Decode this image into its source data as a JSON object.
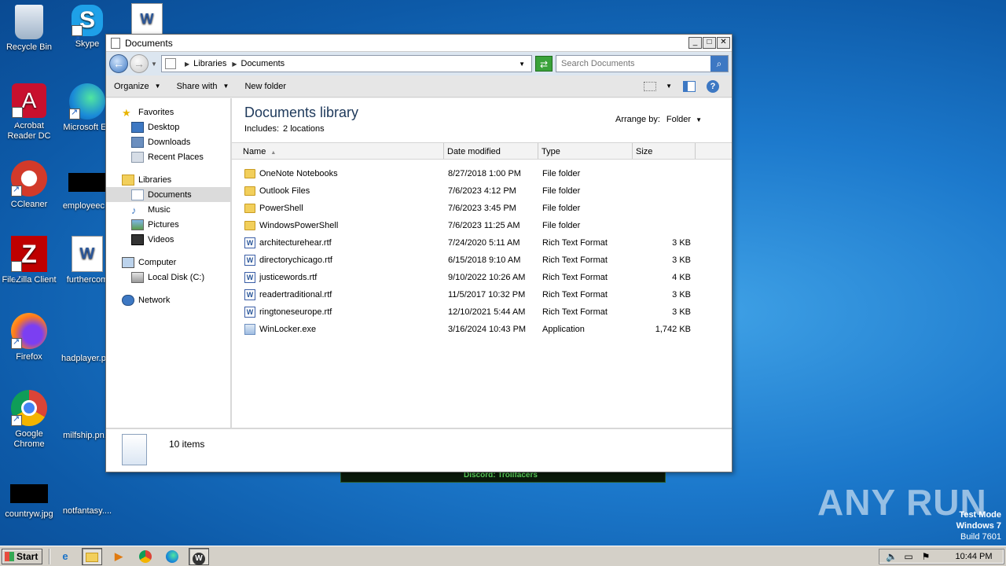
{
  "desktop": {
    "icons": [
      {
        "label": "Recycle Bin"
      },
      {
        "label": "Skype"
      },
      {
        "label": "Acrobat Reader DC"
      },
      {
        "label": "Microsoft Ed"
      },
      {
        "label": "CCleaner"
      },
      {
        "label": "employeec..."
      },
      {
        "label": "FileZilla Client"
      },
      {
        "label": "furthercom"
      },
      {
        "label": "Firefox"
      },
      {
        "label": "hadplayer.p..."
      },
      {
        "label": "Google Chrome"
      },
      {
        "label": "milfship.pn..."
      },
      {
        "label": "countryw.jpg"
      },
      {
        "label": "notfantasy...."
      }
    ]
  },
  "background_window": {
    "text": "Discord: Trollfacers"
  },
  "window": {
    "title": "Documents",
    "address": {
      "crumbs": [
        "Libraries",
        "Documents"
      ]
    },
    "search": {
      "placeholder": "Search Documents"
    },
    "toolbar": {
      "organize": "Organize",
      "share_with": "Share with",
      "new_folder": "New folder"
    },
    "nav": {
      "favorites": {
        "label": "Favorites",
        "items": [
          "Desktop",
          "Downloads",
          "Recent Places"
        ]
      },
      "libraries": {
        "label": "Libraries",
        "items": [
          "Documents",
          "Music",
          "Pictures",
          "Videos"
        ]
      },
      "computer": {
        "label": "Computer",
        "items": [
          "Local Disk (C:)"
        ]
      },
      "network": {
        "label": "Network"
      }
    },
    "library": {
      "title": "Documents library",
      "includes_label": "Includes:",
      "includes_value": "2 locations",
      "arrange_label": "Arrange by:",
      "arrange_value": "Folder"
    },
    "columns": {
      "name": "Name",
      "date": "Date modified",
      "type": "Type",
      "size": "Size"
    },
    "files": [
      {
        "name": "OneNote Notebooks",
        "date": "8/27/2018 1:00 PM",
        "type": "File folder",
        "size": "",
        "kind": "folder"
      },
      {
        "name": "Outlook Files",
        "date": "7/6/2023 4:12 PM",
        "type": "File folder",
        "size": "",
        "kind": "folder"
      },
      {
        "name": "PowerShell",
        "date": "7/6/2023 3:45 PM",
        "type": "File folder",
        "size": "",
        "kind": "folder"
      },
      {
        "name": "WindowsPowerShell",
        "date": "7/6/2023 11:25 AM",
        "type": "File folder",
        "size": "",
        "kind": "folder"
      },
      {
        "name": "architecturehear.rtf",
        "date": "7/24/2020 5:11 AM",
        "type": "Rich Text Format",
        "size": "3 KB",
        "kind": "rtf"
      },
      {
        "name": "directorychicago.rtf",
        "date": "6/15/2018 9:10 AM",
        "type": "Rich Text Format",
        "size": "3 KB",
        "kind": "rtf"
      },
      {
        "name": "justicewords.rtf",
        "date": "9/10/2022 10:26 AM",
        "type": "Rich Text Format",
        "size": "4 KB",
        "kind": "rtf"
      },
      {
        "name": "readertraditional.rtf",
        "date": "11/5/2017 10:32 PM",
        "type": "Rich Text Format",
        "size": "3 KB",
        "kind": "rtf"
      },
      {
        "name": "ringtoneseurope.rtf",
        "date": "12/10/2021 5:44 AM",
        "type": "Rich Text Format",
        "size": "3 KB",
        "kind": "rtf"
      },
      {
        "name": "WinLocker.exe",
        "date": "3/16/2024 10:43 PM",
        "type": "Application",
        "size": "1,742 KB",
        "kind": "exe"
      }
    ],
    "status": {
      "count": "10 items"
    }
  },
  "watermark": {
    "brand": "ANY RUN",
    "mode": "Test Mode",
    "os": "Windows 7",
    "build": "Build 7601"
  },
  "taskbar": {
    "start": "Start",
    "clock": "10:44 PM"
  }
}
